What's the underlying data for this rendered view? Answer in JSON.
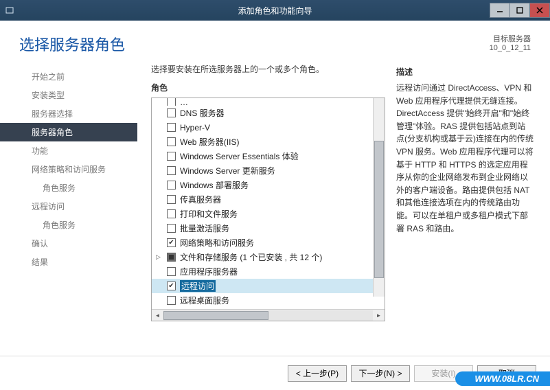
{
  "window": {
    "title": "添加角色和功能向导"
  },
  "header": {
    "page_title": "选择服务器角色",
    "target_label": "目标服务器",
    "target_value": "10_0_12_11"
  },
  "sidebar": {
    "items": [
      {
        "label": "开始之前",
        "active": false
      },
      {
        "label": "安装类型",
        "active": false
      },
      {
        "label": "服务器选择",
        "active": false
      },
      {
        "label": "服务器角色",
        "active": true
      },
      {
        "label": "功能",
        "active": false
      },
      {
        "label": "网络策略和访问服务",
        "active": false
      },
      {
        "label": "角色服务",
        "active": false,
        "sub": true
      },
      {
        "label": "远程访问",
        "active": false
      },
      {
        "label": "角色服务",
        "active": false,
        "sub": true
      },
      {
        "label": "确认",
        "active": false
      },
      {
        "label": "结果",
        "active": false
      }
    ]
  },
  "main": {
    "instruction": "选择要安装在所选服务器上的一个或多个角色。",
    "roles_heading": "角色",
    "desc_heading": "描述",
    "roles": [
      {
        "label": "DNS 服务器",
        "checked": false
      },
      {
        "label": "Hyper-V",
        "checked": false
      },
      {
        "label": "Web 服务器(IIS)",
        "checked": false
      },
      {
        "label": "Windows Server Essentials 体验",
        "checked": false
      },
      {
        "label": "Windows Server 更新服务",
        "checked": false
      },
      {
        "label": "Windows 部署服务",
        "checked": false
      },
      {
        "label": "传真服务器",
        "checked": false
      },
      {
        "label": "打印和文件服务",
        "checked": false
      },
      {
        "label": "批量激活服务",
        "checked": false
      },
      {
        "label": "网络策略和访问服务",
        "checked": true
      },
      {
        "label": "文件和存储服务 (1 个已安装 , 共 12 个)",
        "checked": "tri",
        "expander": true
      },
      {
        "label": "应用程序服务器",
        "checked": false
      },
      {
        "label": "远程访问",
        "checked": true,
        "highlight": true
      },
      {
        "label": "远程桌面服务",
        "checked": false
      }
    ],
    "description": "远程访问通过 DirectAccess、VPN 和 Web 应用程序代理提供无缝连接。DirectAccess 提供\"始终开启\"和\"始终管理\"体验。RAS 提供包括站点到站点(分支机构或基于云)连接在内的传统 VPN 服务。Web 应用程序代理可以将基于 HTTP 和 HTTPS 的选定应用程序从你的企业网络发布到企业网络以外的客户端设备。路由提供包括 NAT 和其他连接选项在内的传统路由功能。可以在单租户或多租户模式下部署 RAS 和路由。"
  },
  "footer": {
    "prev": "< 上一步(P)",
    "next": "下一步(N) >",
    "install": "安装(I)",
    "cancel": "取消"
  },
  "watermark": "WWW.08LR.CN"
}
